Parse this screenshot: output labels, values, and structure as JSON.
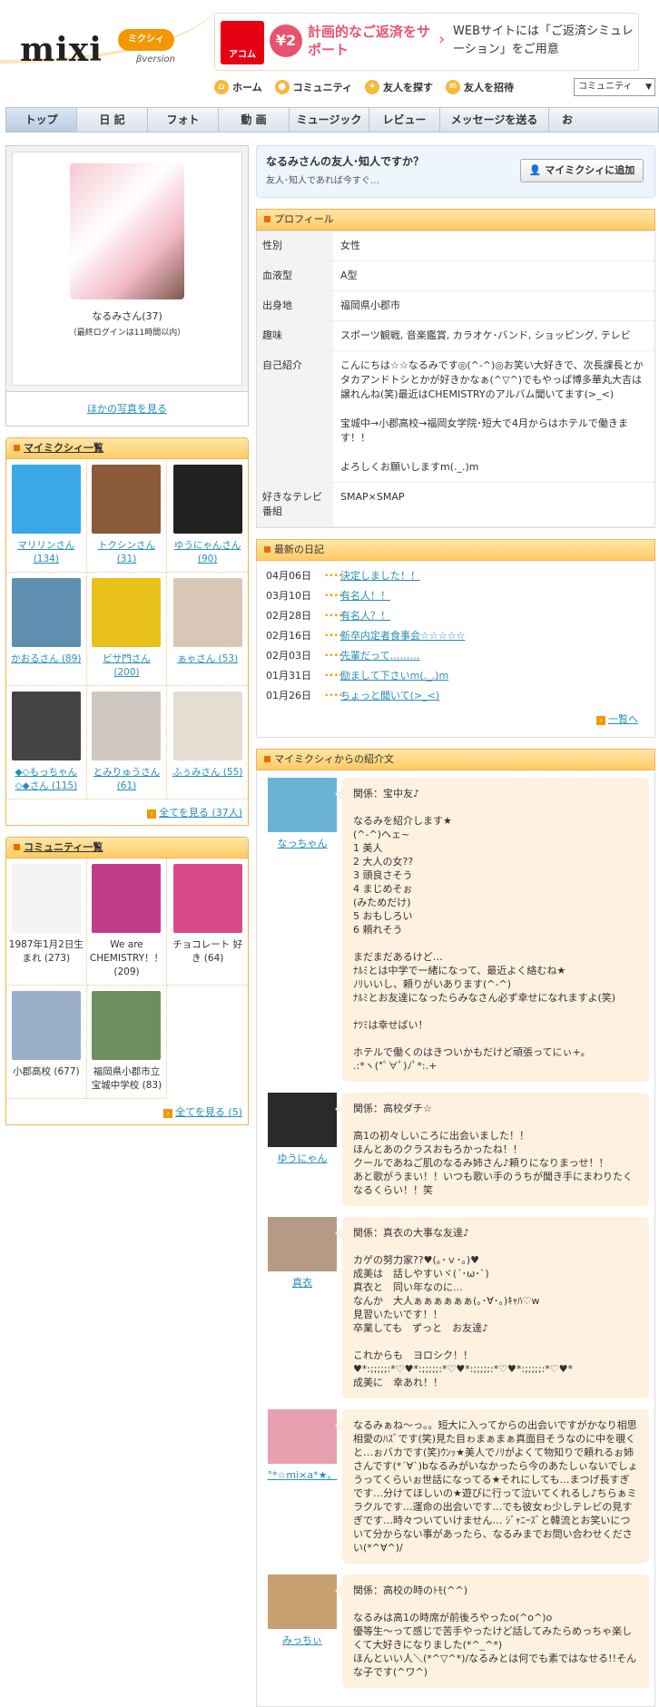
{
  "header": {
    "logo": "mixi",
    "logo_badge": "ミクシィ",
    "logo_version": "βversion",
    "ad": {
      "brand": "アコム",
      "yen": "¥2",
      "headline": "計画的なご返済をサポート",
      "sub": "WEBサイトには「ご返済シミュレーション」をご用意"
    },
    "topnav": [
      {
        "label": "ホーム",
        "icon": "home-icon"
      },
      {
        "label": "コミュニティ",
        "icon": "community-icon"
      },
      {
        "label": "友人を探す",
        "icon": "search-friend-icon"
      },
      {
        "label": "友人を招待",
        "icon": "invite-mail-icon"
      }
    ],
    "search_select": "コミュニティ"
  },
  "globalnav": [
    "トップ",
    "日 記",
    "フォト",
    "動 画",
    "ミュージック",
    "レビュー",
    "メッセージを送る",
    "お"
  ],
  "profile_card": {
    "name": "なるみさん(37)",
    "last_login": "（最終ログインは11時間以内）",
    "more_photos": "ほかの写真を見る"
  },
  "mymixi": {
    "title": "マイミクシィ一覧",
    "items": [
      {
        "name": "マリリンさん (134)",
        "color": "#3aa7e6"
      },
      {
        "name": "トクシンさん (31)",
        "color": "#8a5a3a"
      },
      {
        "name": "ゆうにゃんさん (90)",
        "color": "#222222"
      },
      {
        "name": "かおるさん (89)",
        "color": "#5f8fb0"
      },
      {
        "name": "ビサ門さん (200)",
        "color": "#e8c21a"
      },
      {
        "name": "ぁゃさん (53)",
        "color": "#d9c8b8"
      },
      {
        "name": "◆◇もっちゃん◇◆さん (115)",
        "color": "#444444"
      },
      {
        "name": "とみりゅうさん (61)",
        "color": "#cfc8c0"
      },
      {
        "name": "ふぅみさん (55)",
        "color": "#e4ded0"
      }
    ],
    "see_all": "全てを見る (37人)"
  },
  "community": {
    "title": "コミュニティ一覧",
    "items": [
      {
        "name": "1987年1月2日生まれ (273)",
        "color": "#f4f4f4"
      },
      {
        "name": "We are CHEMISTRY！！ (209)",
        "color": "#c23b8a"
      },
      {
        "name": "チョコレート 好き (64)",
        "color": "#d94a8a"
      },
      {
        "name": "小郡高校 (677)",
        "color": "#9aaec8"
      },
      {
        "name": "福岡県小郡市立宝城中学校 (83)",
        "color": "#6d8f5f"
      }
    ],
    "see_all": "全てを見る (5)"
  },
  "friend_question": {
    "question": "なるみさんの友人･知人ですか？",
    "sub": "友人･知人であれば今すぐ…",
    "button": "マイミクシィに追加"
  },
  "profile": {
    "title": "プロフィール",
    "rows": [
      {
        "key": "性別",
        "value": "女性"
      },
      {
        "key": "血液型",
        "value": "A型"
      },
      {
        "key": "出身地",
        "value": "福岡県小郡市"
      },
      {
        "key": "趣味",
        "value": "スポーツ観戦, 音楽鑑賞, カラオケ･バンド, ショッピング, テレビ"
      },
      {
        "key": "自己紹介",
        "value": "こんにちは☆☆なるみです◎(^-^)◎お笑い大好きで、次長課長とかタカアンドトシとかが好きかなぁ(^▽^)でもやっぱ博多華丸大吉は譲れんね(笑)最近はCHEMISTRYのアルバム聞いてます(>_<)\n\n宝城中→小郡高校→福岡女学院･短大で4月からはホテルで働きます！！\n\nよろしくお願いしますm(._.)m"
      },
      {
        "key": "好きなテレビ番組",
        "value": "SMAP×SMAP"
      }
    ]
  },
  "diary": {
    "title": "最新の日記",
    "entries": [
      {
        "date": "04月06日",
        "title": "決定しました！！"
      },
      {
        "date": "03月10日",
        "title": "有名人！！"
      },
      {
        "date": "02月28日",
        "title": "有名人？！"
      },
      {
        "date": "02月16日",
        "title": "新卒内定者食事会☆☆☆☆☆"
      },
      {
        "date": "02月03日",
        "title": "先輩だって………"
      },
      {
        "date": "01月31日",
        "title": "励まして下さいm(._.)m"
      },
      {
        "date": "01月26日",
        "title": "ちょっと聞いて(>_<)"
      }
    ],
    "more": "一覧へ"
  },
  "intro": {
    "title": "マイミクシィからの紹介文",
    "entries": [
      {
        "name": "なっちゃん",
        "color": "#6ab3d6",
        "text": "関係：宝中友♪\n\nなるみを紹介します★\n(^-^)ヘェ~\n1 美人\n2 大人の女??\n3 頭良さそう\n4 まじめそぉ\n(みためだけ)\n5 おもしろい\n6 頼れそう\n\nまだまだあるけど…\nﾅﾙﾐとは中学で一緒になって、最近よく絡むね★\nﾉﾘいいし、頼りがいあります(^-^)\nﾅﾙﾐとお友達になったらみなさん必ず幸せになれますよ(笑)\n\nﾅﾂﾐは幸せばい！\n\nホテルで働くのはきついかもだけど頑張ってにぃ+。\n.:*ヽ(*ﾟ∀ﾟ)ﾉﾟ*:.+"
      },
      {
        "name": "ゆうにゃん",
        "color": "#2a2a2a",
        "text": "関係：高校ダチ☆\n\n高1の初々しいころに出会いました！！\nほんとあのクラスおもろかったね！！\nクールであねご肌のなるみ姉さん♪頼りになりまっせ！！\nあと歌がうまい！！いつも歌い手のうちが聞き手にまわりたくなるくらい！！笑"
      },
      {
        "name": "真衣",
        "color": "#b59a85",
        "text": "関係：真衣の大事な友達♪\n\nカゲの努力家??♥(｡･ｖ･｡)♥\n成美は　話しやすいヾ(´･ω･`)\n真衣と　同い年なのに…\nなんか　大人ぁぁぁぁぁぁ(｡･∀･｡)ｷｬﾊ♡w\n見習いたいです！！\n卒業しても　ずっと　お友達♪\n\nこれからも　ヨロシク！！\n♥*:;;;;;:*♡♥*:;;;;;:*♡♥*:;;;;;:*♡♥*:;;;;;:*♡♥*\n成美に　幸あれ！！"
      },
      {
        "name": "°*☆mi×a*★。",
        "color": "#e8a0b0",
        "text": "なるみぁね～っ。。短大に入ってからの出会いですがかなり相思相愛のﾊｽﾞです(笑)見た目ゎまぁまぁ真面目そうなのに中を覗くと…ぉバカです(笑)ｳﾝｯ★美人でﾉﾘがよくて物知りで頼れるぉ姉さんです(*´∀`)bなるみがいなかったら今のあたしぃないでしょうってくらいぉ世話になってる★それにしても…まつげ長すぎです…分けてほしいの★遊びに行って泣いてくれるし♪ちらぁミラクルです…運命の出会いです…でも彼女ゎ少しテレビの見すぎです…時々ついていけません… ｼﾞｬﾆｰｽﾞと韓流とお笑いについて分からない事があったら、なるみまでお問い合わせください(*^∀^)/"
      },
      {
        "name": "みっちぃ",
        "color": "#c8a070",
        "text": "関係：高校の時のﾄﾓ(^^)\n\nなるみは高1の時席が前後ろやったo(^o^)o\n優等生～って感じで苦手やったけど話してみたらめっちゃ楽しくて大好きになりました(*^_^*)\nほんといい人＼(*^▽^*)/なるみとは何でも素ではなせる!!そんな子です(^ワ^)"
      }
    ]
  }
}
